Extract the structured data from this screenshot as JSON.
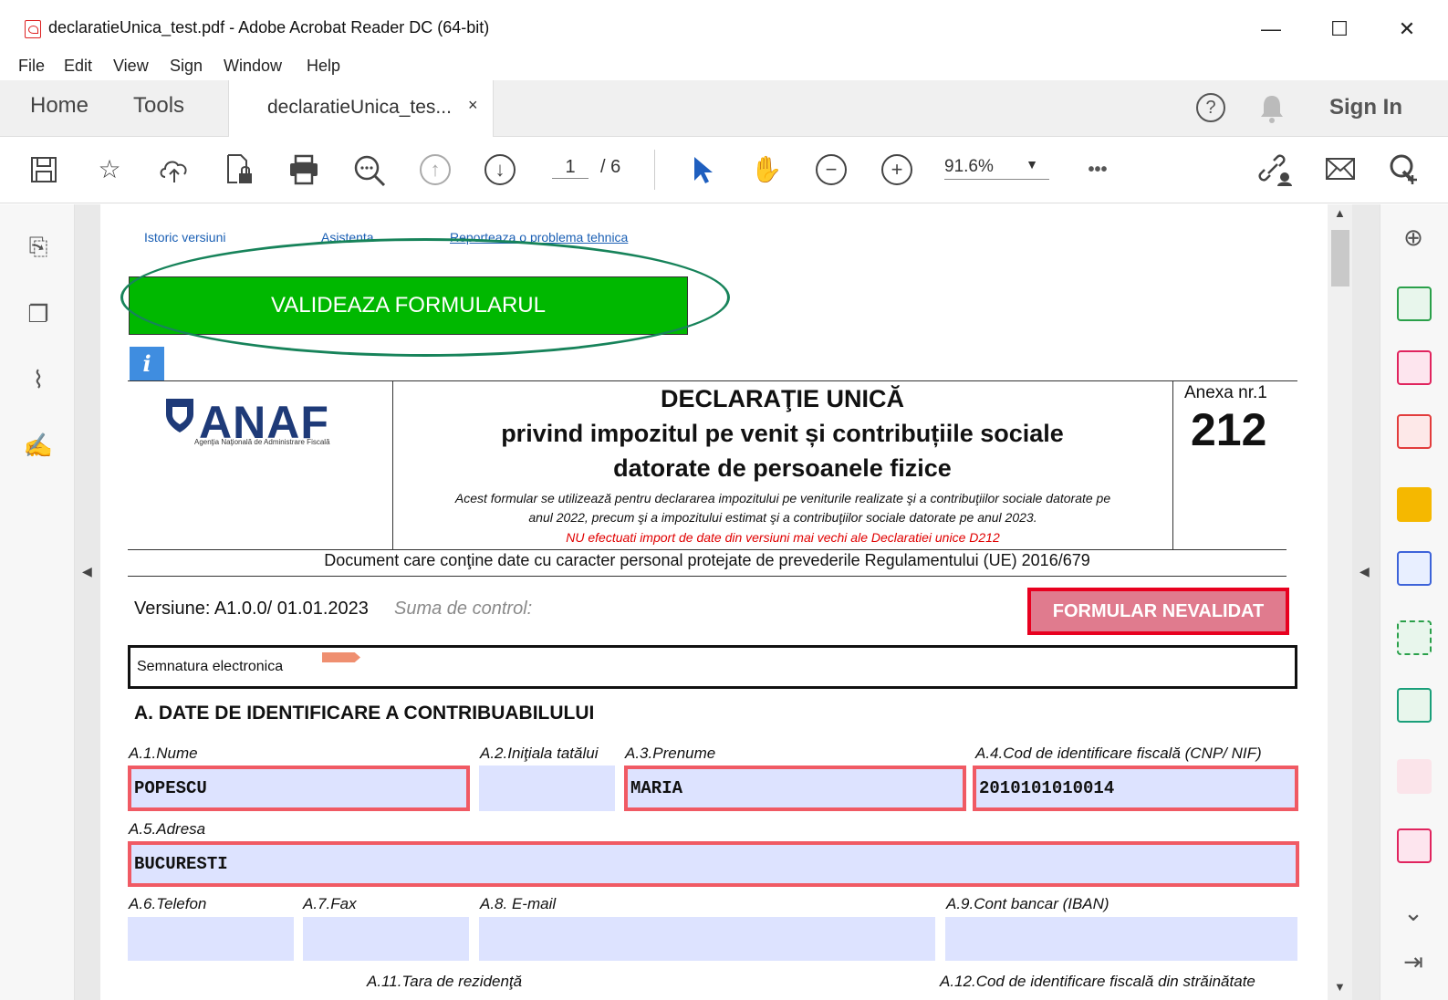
{
  "window": {
    "title": "declaratieUnica_test.pdf - Adobe Acrobat Reader DC (64-bit)",
    "minimize": "—",
    "maximize": "☐",
    "close": "✕"
  },
  "menu": [
    "File",
    "Edit",
    "View",
    "Sign",
    "Window",
    "Help"
  ],
  "tabs": {
    "home": "Home",
    "tools": "Tools",
    "document": "declaratieUnica_tes...",
    "document_close": "×",
    "help": "?",
    "sign_in": "Sign In"
  },
  "toolbar": {
    "page_current": "1",
    "page_total": "/ 6",
    "zoom": "91.6%",
    "more": "•••"
  },
  "page": {
    "links": {
      "history": "Istoric versiuni",
      "assistance": "Asistenta",
      "report": "Reporteaza o problema tehnica"
    },
    "validate_button": "VALIDEAZA FORMULARUL",
    "info_icon": "i",
    "logo": {
      "text": "ANAF",
      "subtitle": "Agenţia Naţională de Administrare Fiscală"
    },
    "title_line1": "DECLARAŢIE UNICĂ",
    "title_line2": "privind impozitul pe venit și contribuțiile sociale",
    "title_line3": "datorate de persoanele fizice",
    "note_line1": "Acest formular se utilizează pentru declararea impozitului pe veniturile realizate şi a contribuţiilor sociale datorate  pe",
    "note_line2": "anul 2022, precum şi a impozitului estimat şi a contribuţiilor sociale datorate pe  anul 2023.",
    "note_line3": "NU efectuati import de date din versiuni mai vechi ale Declaratiei unice D212",
    "anexa_label": "Anexa nr.1",
    "anexa_number": "212",
    "personal_data_note": "Document care conţine date cu caracter personal protejate de prevederile Regulamentului (UE) 2016/679",
    "version": "Versiune:  A1.0.0/ 01.01.2023",
    "checksum_label": "Suma de  control:",
    "status_button": "FORMULAR NEVALIDAT",
    "signature_label": "Semnatura electronica",
    "section_a_title": "A. DATE DE IDENTIFICARE A CONTRIBUABILULUI",
    "fields": {
      "a1_label": "A.1.Nume",
      "a1_value": "POPESCU",
      "a2_label": "A.2.Iniţiala tatălui",
      "a2_value": "",
      "a3_label": "A.3.Prenume",
      "a3_value": "MARIA",
      "a4_label": "A.4.Cod de identificare fiscală (CNP/ NIF)",
      "a4_value": "2010101010014",
      "a5_label": "A.5.Adresa",
      "a5_value": "BUCURESTI",
      "a6_label": "A.6.Telefon",
      "a6_value": "",
      "a7_label": "A.7.Fax",
      "a7_value": "",
      "a8_label": "A.8. E-mail",
      "a8_value": "",
      "a9_label": "A.9.Cont bancar (IBAN)",
      "a9_value": "",
      "a11_label": "A.11.Tara de rezidenţă",
      "a12_label": "A.12.Cod de identificare fiscală din străinătate"
    }
  },
  "colors": {
    "validate_green": "#00b800",
    "ellipse_green": "#17835a",
    "error_border": "#f05a64",
    "invalid_fill": "#e07b8e",
    "field_fill": "#dde3ff",
    "anaf_blue": "#1e3a78"
  }
}
